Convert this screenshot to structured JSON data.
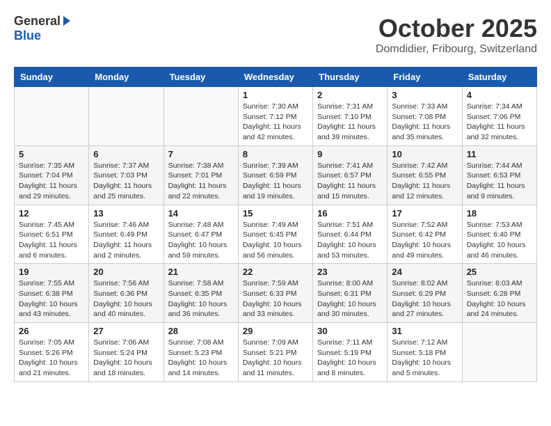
{
  "header": {
    "logo": {
      "general": "General",
      "blue": "Blue"
    },
    "title": "October 2025",
    "location": "Domdidier, Fribourg, Switzerland"
  },
  "days_of_week": [
    "Sunday",
    "Monday",
    "Tuesday",
    "Wednesday",
    "Thursday",
    "Friday",
    "Saturday"
  ],
  "weeks": [
    {
      "days": [
        {
          "num": "",
          "info": ""
        },
        {
          "num": "",
          "info": ""
        },
        {
          "num": "",
          "info": ""
        },
        {
          "num": "1",
          "info": "Sunrise: 7:30 AM\nSunset: 7:12 PM\nDaylight: 11 hours\nand 42 minutes."
        },
        {
          "num": "2",
          "info": "Sunrise: 7:31 AM\nSunset: 7:10 PM\nDaylight: 11 hours\nand 39 minutes."
        },
        {
          "num": "3",
          "info": "Sunrise: 7:33 AM\nSunset: 7:08 PM\nDaylight: 11 hours\nand 35 minutes."
        },
        {
          "num": "4",
          "info": "Sunrise: 7:34 AM\nSunset: 7:06 PM\nDaylight: 11 hours\nand 32 minutes."
        }
      ]
    },
    {
      "days": [
        {
          "num": "5",
          "info": "Sunrise: 7:35 AM\nSunset: 7:04 PM\nDaylight: 11 hours\nand 29 minutes."
        },
        {
          "num": "6",
          "info": "Sunrise: 7:37 AM\nSunset: 7:03 PM\nDaylight: 11 hours\nand 25 minutes."
        },
        {
          "num": "7",
          "info": "Sunrise: 7:38 AM\nSunset: 7:01 PM\nDaylight: 11 hours\nand 22 minutes."
        },
        {
          "num": "8",
          "info": "Sunrise: 7:39 AM\nSunset: 6:59 PM\nDaylight: 11 hours\nand 19 minutes."
        },
        {
          "num": "9",
          "info": "Sunrise: 7:41 AM\nSunset: 6:57 PM\nDaylight: 11 hours\nand 15 minutes."
        },
        {
          "num": "10",
          "info": "Sunrise: 7:42 AM\nSunset: 6:55 PM\nDaylight: 11 hours\nand 12 minutes."
        },
        {
          "num": "11",
          "info": "Sunrise: 7:44 AM\nSunset: 6:53 PM\nDaylight: 11 hours\nand 9 minutes."
        }
      ]
    },
    {
      "days": [
        {
          "num": "12",
          "info": "Sunrise: 7:45 AM\nSunset: 6:51 PM\nDaylight: 11 hours\nand 6 minutes."
        },
        {
          "num": "13",
          "info": "Sunrise: 7:46 AM\nSunset: 6:49 PM\nDaylight: 11 hours\nand 2 minutes."
        },
        {
          "num": "14",
          "info": "Sunrise: 7:48 AM\nSunset: 6:47 PM\nDaylight: 10 hours\nand 59 minutes."
        },
        {
          "num": "15",
          "info": "Sunrise: 7:49 AM\nSunset: 6:45 PM\nDaylight: 10 hours\nand 56 minutes."
        },
        {
          "num": "16",
          "info": "Sunrise: 7:51 AM\nSunset: 6:44 PM\nDaylight: 10 hours\nand 53 minutes."
        },
        {
          "num": "17",
          "info": "Sunrise: 7:52 AM\nSunset: 6:42 PM\nDaylight: 10 hours\nand 49 minutes."
        },
        {
          "num": "18",
          "info": "Sunrise: 7:53 AM\nSunset: 6:40 PM\nDaylight: 10 hours\nand 46 minutes."
        }
      ]
    },
    {
      "days": [
        {
          "num": "19",
          "info": "Sunrise: 7:55 AM\nSunset: 6:38 PM\nDaylight: 10 hours\nand 43 minutes."
        },
        {
          "num": "20",
          "info": "Sunrise: 7:56 AM\nSunset: 6:36 PM\nDaylight: 10 hours\nand 40 minutes."
        },
        {
          "num": "21",
          "info": "Sunrise: 7:58 AM\nSunset: 6:35 PM\nDaylight: 10 hours\nand 36 minutes."
        },
        {
          "num": "22",
          "info": "Sunrise: 7:59 AM\nSunset: 6:33 PM\nDaylight: 10 hours\nand 33 minutes."
        },
        {
          "num": "23",
          "info": "Sunrise: 8:00 AM\nSunset: 6:31 PM\nDaylight: 10 hours\nand 30 minutes."
        },
        {
          "num": "24",
          "info": "Sunrise: 8:02 AM\nSunset: 6:29 PM\nDaylight: 10 hours\nand 27 minutes."
        },
        {
          "num": "25",
          "info": "Sunrise: 8:03 AM\nSunset: 6:28 PM\nDaylight: 10 hours\nand 24 minutes."
        }
      ]
    },
    {
      "days": [
        {
          "num": "26",
          "info": "Sunrise: 7:05 AM\nSunset: 5:26 PM\nDaylight: 10 hours\nand 21 minutes."
        },
        {
          "num": "27",
          "info": "Sunrise: 7:06 AM\nSunset: 5:24 PM\nDaylight: 10 hours\nand 18 minutes."
        },
        {
          "num": "28",
          "info": "Sunrise: 7:08 AM\nSunset: 5:23 PM\nDaylight: 10 hours\nand 14 minutes."
        },
        {
          "num": "29",
          "info": "Sunrise: 7:09 AM\nSunset: 5:21 PM\nDaylight: 10 hours\nand 11 minutes."
        },
        {
          "num": "30",
          "info": "Sunrise: 7:11 AM\nSunset: 5:19 PM\nDaylight: 10 hours\nand 8 minutes."
        },
        {
          "num": "31",
          "info": "Sunrise: 7:12 AM\nSunset: 5:18 PM\nDaylight: 10 hours\nand 5 minutes."
        },
        {
          "num": "",
          "info": ""
        }
      ]
    }
  ]
}
